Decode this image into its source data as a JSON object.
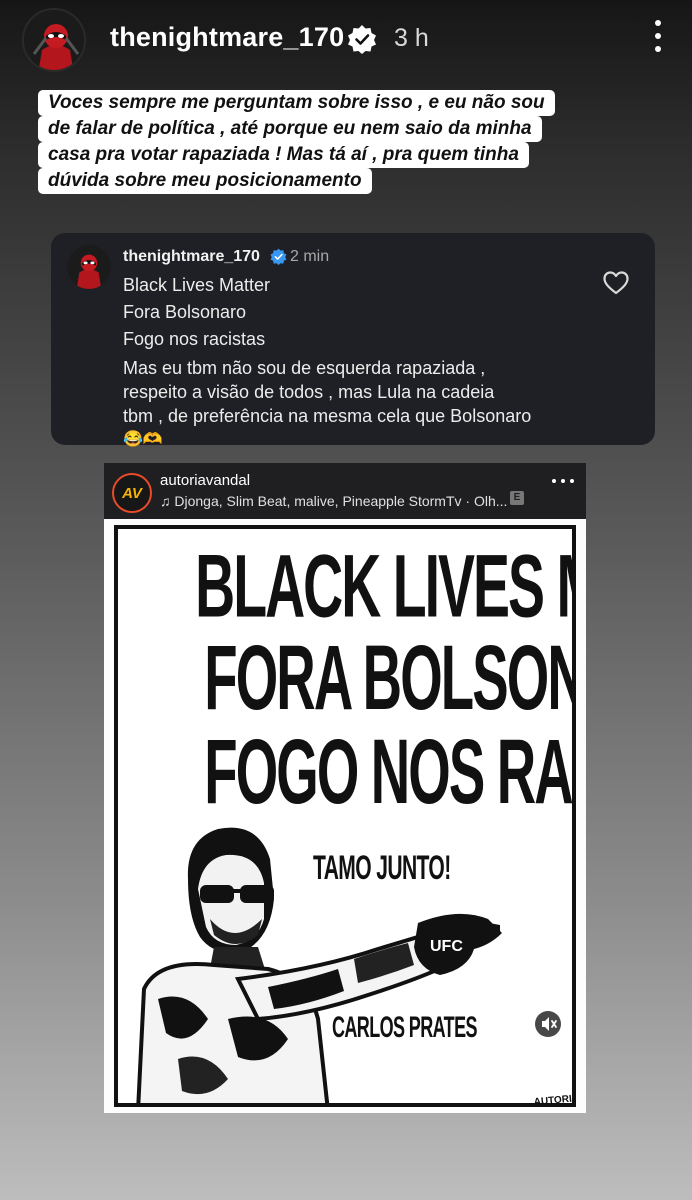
{
  "story_header": {
    "username": "thenightmare_170",
    "time": "3 h",
    "icons": {
      "avatar": "avatar-deadpool",
      "verified": "verified-badge-icon",
      "more": "more-vertical-icon"
    }
  },
  "caption": {
    "lines": [
      "Voces sempre me perguntam sobre isso , e eu não sou",
      "de falar de política , até porque eu nem saio da minha",
      "casa pra votar rapaziada !  Mas tá aí , pra quem tinha",
      "dúvida sobre meu posicionamento"
    ]
  },
  "reply_card": {
    "username": "thenightmare_170",
    "time": "2 min",
    "lines": [
      "Black Lives Matter",
      "Fora Bolsonaro",
      "Fogo nos racistas",
      "Mas eu tbm não sou de esquerda rapaziada ,",
      "respeito a visão de todos , mas Lula na cadeia",
      "tbm , de preferência na mesma cela que Bolsonaro",
      "😂🫶"
    ],
    "icons": {
      "heart": "heart-outline-icon"
    }
  },
  "shared_post": {
    "username": "autoriavandal",
    "avatar_text": "AV",
    "music": "♫ Djonga, Slim Beat, malive, Pineapple StormTv · Olh...",
    "explicit_badge": "E",
    "poster": {
      "headline_1": "BLACK LIVES MATTER",
      "headline_2": "FORA BOLSONARO",
      "headline_3": "FOGO NOS RACISTAS",
      "tagline": "TAMO JUNTO!",
      "name": "CARLOS PRATES",
      "glove_text": "UFC",
      "signature": "AUTORIAVANDAL"
    },
    "icons": {
      "more": "more-horizontal-icon",
      "mute": "speaker-muted-icon"
    }
  },
  "colors": {
    "card_bg": "#1e2025",
    "verified": "#3897f0",
    "poster_ink": "#111111",
    "avatar_ring": "#e74b28"
  }
}
